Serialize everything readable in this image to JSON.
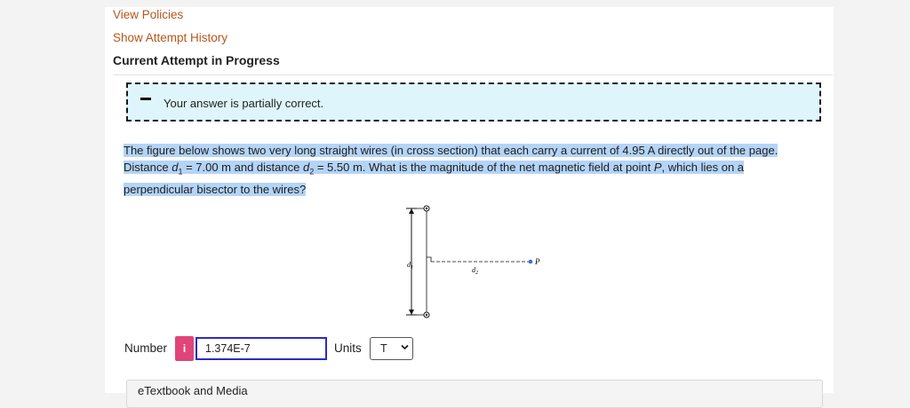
{
  "nav": {
    "view_policies": "View Policies",
    "show_attempt_history": "Show Attempt History",
    "current_attempt": "Current Attempt in Progress"
  },
  "feedback": {
    "message": "Your answer is partially correct."
  },
  "question": {
    "line1": "The figure below shows two very long straight wires (in cross section) that each carry a current of 4.95 A directly out of the page.",
    "line2_pre_d1": "Distance ",
    "d1_var": "d",
    "d1_sub": "1",
    "line2_mid": " = 7.00 m and distance ",
    "d2_var": "d",
    "d2_sub": "2",
    "line2_post": " = 5.50 m. What is the magnitude of the net magnetic field at point ",
    "point_var": "P",
    "line2_end": ", which lies on a",
    "line3": "perpendicular bisector to the wires?"
  },
  "figure": {
    "d1_label_var": "d",
    "d1_label_sub": "1",
    "d2_label_var": "d",
    "d2_label_sub": "2",
    "point_label": "P"
  },
  "answer": {
    "number_label": "Number",
    "info_icon": "i",
    "value": "1.374E-7",
    "units_label": "Units",
    "units_value": "T",
    "dropdown_icon": "chevron-down-icon"
  },
  "textbook": {
    "label": "eTextbook and Media"
  },
  "colors": {
    "link": "#b5561b",
    "feedback_bg": "#def6fb",
    "highlight": "#b4d4f7",
    "info_btn": "#e0457a",
    "input_border": "#2b2bc9",
    "point_dot": "#3a6fd8"
  }
}
